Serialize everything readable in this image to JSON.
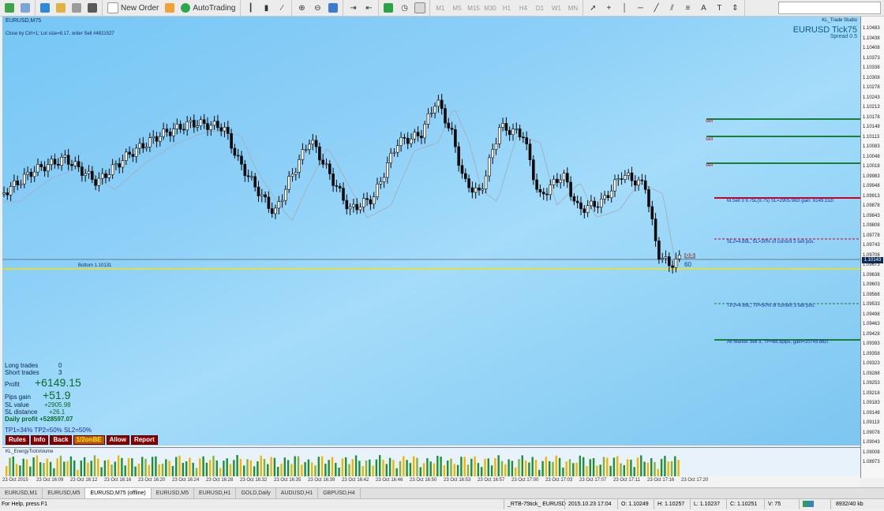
{
  "toolbar": {
    "new_order_label": "New Order",
    "autotrading_label": "AutoTrading",
    "timeframes": [
      "M1",
      "M5",
      "M15",
      "M30",
      "H1",
      "H4",
      "D1",
      "W1",
      "MN"
    ]
  },
  "chart": {
    "symbol_period": "EURUSD,M75",
    "hint": "Close by Ctrl+1; Lot size=8.17,  order Sell #4821527",
    "studio": "KL_Trade Studio",
    "tick_title": "EURUSD Tick75",
    "spread": "Spread 0.5",
    "bottom_label": "Bottom 1.10131",
    "last_tag": "0.5",
    "count_tag": "60",
    "sell_tags": [
      "sell",
      "sell",
      "sell"
    ],
    "orders": {
      "msell": "M.Sell 3  9.75L(9.75)  SL=2905.98zl  gain: 6149.15zl",
      "sl2": "SL2=4.89L, SL=30%  of current 3 sell pos.",
      "tp2": "TP2=4.89L, TP=50%  of current 3 sell pos.",
      "all_market": "All Market Sell 3, TP=88.5pips, gain=10745.86zl"
    },
    "colors": {
      "sell_line": "#cc0022",
      "tp_line": "#16803a",
      "bottom_line": "#f7e300",
      "accent": "#0b5a8c"
    }
  },
  "price_axis": {
    "labels": [
      "1.10483",
      "1.10438",
      "1.10408",
      "1.10373",
      "1.10338",
      "1.10308",
      "1.10278",
      "1.10243",
      "1.10213",
      "1.10178",
      "1.10148",
      "1.10113",
      "1.10083",
      "1.10048",
      "1.10018",
      "1.09983",
      "1.09948",
      "1.09913",
      "1.09878",
      "1.09843",
      "1.09808",
      "1.09778",
      "1.09743",
      "1.09708",
      "1.09673",
      "1.09638",
      "1.09603",
      "1.09568",
      "1.09533",
      "1.09498",
      "1.09463",
      "1.09428",
      "1.09393",
      "1.09358",
      "1.09323",
      "1.09288",
      "1.09253",
      "1.09218",
      "1.09183",
      "1.09148",
      "1.09113",
      "1.09078",
      "1.09043",
      "1.09008",
      "1.08973"
    ],
    "last_price": "1.10143"
  },
  "info_panel": {
    "long_trades": {
      "label": "Long trades",
      "value": "0"
    },
    "short_trades": {
      "label": "Short trades",
      "value": "3"
    },
    "profit": {
      "label": "Profit",
      "value": "+6149.15"
    },
    "pips_gain": {
      "label": "Pips gain",
      "value": "+51.9"
    },
    "sl_value": {
      "label": "SL value",
      "value": "+2905.98"
    },
    "sl_distance": {
      "label": "SL distance",
      "value": "+26.1"
    },
    "daily_profit": "Daily profit +528597.07",
    "tp_sl": "TP1=34%  TP2=50%  SL2=50%"
  },
  "buttons": [
    "Rules",
    "Info",
    "Back",
    "1/2onBE",
    "Allow",
    "Report"
  ],
  "indicator": {
    "name": "KL_EnergyTickVolume"
  },
  "time_axis": [
    "23 Oct 2015",
    "23 Oct 16:09",
    "23 Oct 16:12",
    "23 Oct 16:16",
    "23 Oct 16:20",
    "23 Oct 16:24",
    "23 Oct 16:28",
    "23 Oct 16:32",
    "23 Oct 16:35",
    "23 Oct 16:39",
    "23 Oct 16:42",
    "23 Oct 16:46",
    "23 Oct 16:50",
    "23 Oct 16:53",
    "23 Oct 16:57",
    "23 Oct 17:00",
    "23 Oct 17:03",
    "23 Oct 17:07",
    "23 Oct 17:11",
    "23 Oct 17:16",
    "23 Oct 17:20"
  ],
  "tabs": [
    "EURUSD,M1",
    "EURUSD,M5",
    "EURUSD,M75 (offline)",
    "EURUSD,M5",
    "EURUSD,H1",
    "GOLD,Daily",
    "AUDUSD,H1",
    "GBPUSD,H4"
  ],
  "active_tab": 2,
  "status": {
    "help": "For Help, press F1",
    "profile": "_RTB-75tick_ EURUSD",
    "datetime": "2015.10.23 17:04",
    "open": "O: 1.10249",
    "high": "H: 1.10257",
    "low": "L: 1.10237",
    "close": "C: 1.10251",
    "volume": "V: 75",
    "traffic": "8932/40 kb"
  }
}
